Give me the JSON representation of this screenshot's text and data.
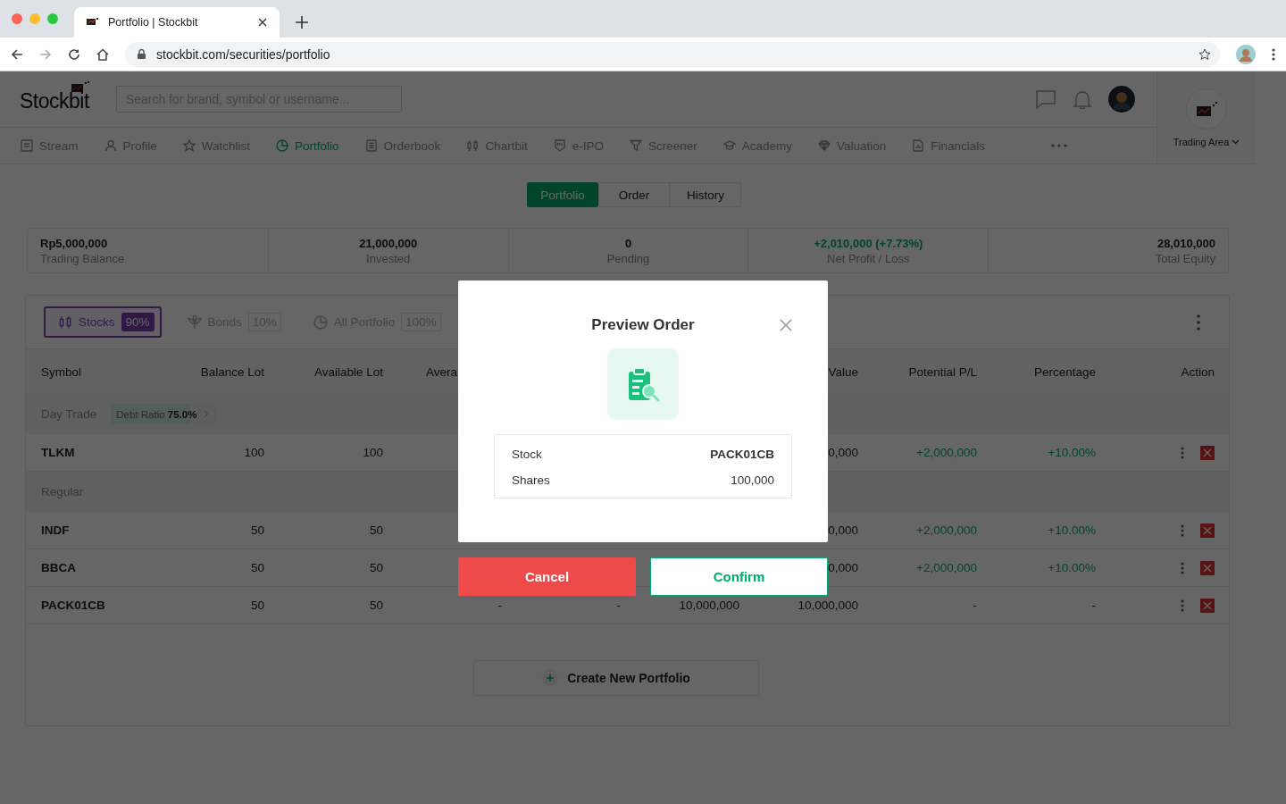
{
  "browser": {
    "tab_title": "Portfolio | Stockbit",
    "url": "stockbit.com/securities/portfolio"
  },
  "header": {
    "logo": "Stockbit",
    "search_placeholder": "Search for brand, symbol or username...",
    "trading_area": "Trading Area"
  },
  "nav": [
    {
      "label": "Stream",
      "selected": false
    },
    {
      "label": "Profile",
      "selected": false
    },
    {
      "label": "Watchlist",
      "selected": false
    },
    {
      "label": "Portfolio",
      "selected": true
    },
    {
      "label": "Orderbook",
      "selected": false
    },
    {
      "label": "Chartbit",
      "selected": false
    },
    {
      "label": "e-IPO",
      "selected": false
    },
    {
      "label": "Screener",
      "selected": false
    },
    {
      "label": "Academy",
      "selected": false
    },
    {
      "label": "Valuation",
      "selected": false
    },
    {
      "label": "Financials",
      "selected": false
    }
  ],
  "segments": [
    {
      "label": "Portfolio",
      "selected": true
    },
    {
      "label": "Order",
      "selected": false
    },
    {
      "label": "History",
      "selected": false
    }
  ],
  "summary": [
    {
      "value": "Rp5,000,000",
      "label": "Trading Balance",
      "gain": false
    },
    {
      "value": "21,000,000",
      "label": "Invested",
      "gain": false
    },
    {
      "value": "0",
      "label": "Pending",
      "gain": false
    },
    {
      "value": "+2,010,000 (+7.73%)",
      "label": "Net Profit / Loss",
      "gain": true
    },
    {
      "value": "28,010,000",
      "label": "Total Equity",
      "gain": false
    }
  ],
  "filters": [
    {
      "label": "Stocks",
      "share": "90%",
      "selected": true
    },
    {
      "label": "Bonds",
      "share": "10%",
      "selected": false
    },
    {
      "label": "All Portfolio",
      "share": "100%",
      "selected": false
    }
  ],
  "columns": [
    "Symbol",
    "Balance Lot",
    "Available Lot",
    "Avera",
    null,
    null,
    "Value",
    "Potential P/L",
    "Percentage",
    "Action"
  ],
  "groups": [
    {
      "name": "Day Trade",
      "debt_ratio": {
        "label": "Debt Ratio",
        "value": "75.0%",
        "level": 0.75
      },
      "rows": [
        {
          "symbol": "TLKM",
          "gain": true,
          "cells": [
            "100",
            "100",
            null,
            null,
            null,
            "0,000",
            "+2,000,000",
            "+10.00%"
          ]
        }
      ]
    },
    {
      "name": "Regular",
      "rows": [
        {
          "symbol": "INDF",
          "gain": true,
          "cells": [
            "50",
            "50",
            null,
            null,
            null,
            "0,000",
            "+2,000,000",
            "+10.00%"
          ]
        },
        {
          "symbol": "BBCA",
          "gain": true,
          "cells": [
            "50",
            "50",
            null,
            null,
            null,
            "0,000",
            "+2,000,000",
            "+10.00%"
          ]
        },
        {
          "symbol": "PACK01CB",
          "gain": false,
          "cells": [
            "50",
            "50",
            "-",
            "-",
            "10,000,000",
            "10,000,000",
            "-",
            "-"
          ]
        }
      ]
    }
  ],
  "create_button": "Create New Portfolio",
  "modal": {
    "title": "Preview Order",
    "details": [
      {
        "label": "Stock",
        "value": "PACK01CB",
        "bold": true
      },
      {
        "label": "Shares",
        "value": "100,000",
        "bold": false
      }
    ],
    "cancel": "Cancel",
    "confirm": "Confirm"
  }
}
